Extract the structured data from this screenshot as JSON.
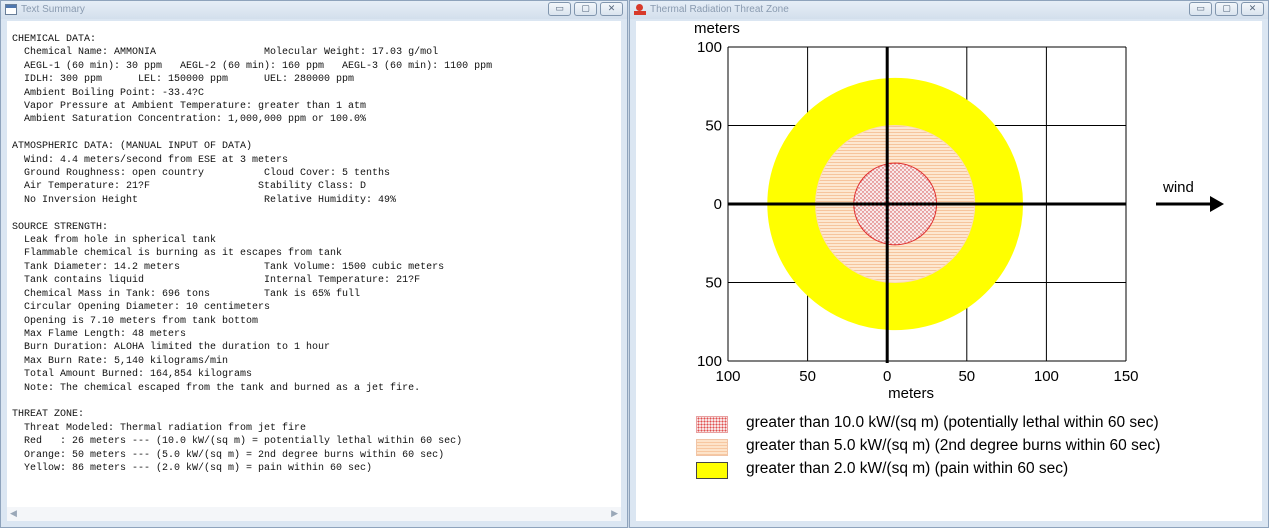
{
  "left_window": {
    "title": "Text Summary",
    "lines": {
      "s1": [
        "CHEMICAL DATA:",
        "  Chemical Name: AMMONIA                  Molecular Weight: 17.03 g/mol",
        "  AEGL-1 (60 min): 30 ppm   AEGL-2 (60 min): 160 ppm   AEGL-3 (60 min): 1100 ppm",
        "  IDLH: 300 ppm      LEL: 150000 ppm      UEL: 280000 ppm",
        "  Ambient Boiling Point: -33.4?C",
        "  Vapor Pressure at Ambient Temperature: greater than 1 atm",
        "  Ambient Saturation Concentration: 1,000,000 ppm or 100.0%"
      ],
      "s2": [
        "ATMOSPHERIC DATA: (MANUAL INPUT OF DATA)",
        "  Wind: 4.4 meters/second from ESE at 3 meters",
        "  Ground Roughness: open country          Cloud Cover: 5 tenths",
        "  Air Temperature: 21?F                  Stability Class: D",
        "  No Inversion Height                     Relative Humidity: 49%"
      ],
      "s3": [
        "SOURCE STRENGTH:",
        "  Leak from hole in spherical tank",
        "  Flammable chemical is burning as it escapes from tank",
        "  Tank Diameter: 14.2 meters              Tank Volume: 1500 cubic meters",
        "  Tank contains liquid                    Internal Temperature: 21?F",
        "  Chemical Mass in Tank: 696 tons         Tank is 65% full",
        "  Circular Opening Diameter: 10 centimeters",
        "  Opening is 7.10 meters from tank bottom",
        "  Max Flame Length: 48 meters",
        "  Burn Duration: ALOHA limited the duration to 1 hour",
        "  Max Burn Rate: 5,140 kilograms/min",
        "  Total Amount Burned: 164,854 kilograms",
        "  Note: The chemical escaped from the tank and burned as a jet fire."
      ],
      "s4": [
        "THREAT ZONE:",
        "  Threat Modeled: Thermal radiation from jet fire",
        "  Red   : 26 meters --- (10.0 kW/(sq m) = potentially lethal within 60 sec)",
        "  Orange: 50 meters --- (5.0 kW/(sq m) = 2nd degree burns within 60 sec)",
        "  Yellow: 86 meters --- (2.0 kW/(sq m) = pain within 60 sec)"
      ]
    }
  },
  "right_window": {
    "title": "Thermal Radiation Threat Zone",
    "wind_label": "wind"
  },
  "window_buttons": {
    "minimize": "▭",
    "maximize": "▢",
    "close": "✕"
  },
  "chart_data": {
    "type": "threat_zone_plot",
    "ylabel": "meters",
    "xlabel": "meters",
    "xlim": [
      -100,
      150
    ],
    "ylim": [
      -100,
      100
    ],
    "x_ticks": [
      "100",
      "50",
      "0",
      "50",
      "100",
      "150"
    ],
    "y_ticks": [
      "100",
      "50",
      "0",
      "50",
      "100"
    ],
    "grid": true,
    "zones": [
      {
        "name": "red",
        "center_x": 5,
        "radius": 26,
        "color": "#e05050",
        "legend": "greater than 10.0 kW/(sq m) (potentially lethal within 60 sec)"
      },
      {
        "name": "orange",
        "center_x": 5,
        "radius": 50,
        "color": "#fce0c4",
        "legend": "greater than 5.0 kW/(sq m) (2nd degree burns within 60 sec)"
      },
      {
        "name": "yellow",
        "center_x": 5,
        "radius": 80,
        "color": "#ffff00",
        "legend": "greater than 2.0 kW/(sq m) (pain within 60 sec)"
      }
    ]
  }
}
